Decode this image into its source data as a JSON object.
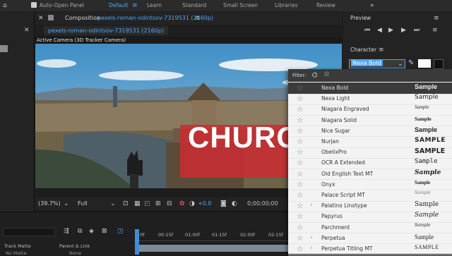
{
  "topbar": {
    "auto_open_label": "Auto-Open Panel",
    "workspaces": [
      "Default",
      "Learn",
      "Standard",
      "Small Screen",
      "Libraries",
      "Review"
    ],
    "active_workspace": "Default",
    "menu_icon": "hamburger-icon",
    "overflow_icon": "double-chevron-icon"
  },
  "composition": {
    "header_label": "Composition",
    "name": "pexels-roman-odintsov-7319531 (2160p)",
    "tab_label": "pexels-roman-odintsov-7319531 (2160p)",
    "camera_label": "Active Camera (3D Tracker Camera)",
    "overlay_text": "CHURCH",
    "overlay_color": "#d02a2f"
  },
  "viewer_toolbar": {
    "zoom": "(39.7%)",
    "resolution": "Full",
    "exposure": "+0.0",
    "timecode": "0;00;00;00"
  },
  "preview_panel": {
    "title": "Preview"
  },
  "character_panel": {
    "title": "Character",
    "font_value": "Nexa Bold"
  },
  "font_menu": {
    "filter_label": "Filter:",
    "fonts": [
      {
        "name": "Nexa Bold",
        "sample": "Sample",
        "expandable": false,
        "selected": true
      },
      {
        "name": "Nexa Light",
        "sample": "Sample",
        "expandable": false,
        "selected": false
      },
      {
        "name": "Niagara Engraved",
        "sample": "Sample",
        "expandable": false,
        "selected": false
      },
      {
        "name": "Niagara Solid",
        "sample": "Sample",
        "expandable": false,
        "selected": false
      },
      {
        "name": "Nice Sugar",
        "sample": "Sample",
        "expandable": false,
        "selected": false
      },
      {
        "name": "Nurjan",
        "sample": "SAMPLE",
        "expandable": false,
        "selected": false
      },
      {
        "name": "ObelixPro",
        "sample": "SAMPLE",
        "expandable": false,
        "selected": false
      },
      {
        "name": "OCR A Extended",
        "sample": "Sample",
        "expandable": false,
        "selected": false
      },
      {
        "name": "Old English Text MT",
        "sample": "Sample",
        "expandable": false,
        "selected": false
      },
      {
        "name": "Onyx",
        "sample": "Sample",
        "expandable": false,
        "selected": false
      },
      {
        "name": "Palace Script MT",
        "sample": "Sample",
        "expandable": false,
        "selected": false
      },
      {
        "name": "Palatino Linotype",
        "sample": "Sample",
        "expandable": true,
        "selected": false
      },
      {
        "name": "Papyrus",
        "sample": "Sample",
        "expandable": false,
        "selected": false
      },
      {
        "name": "Parchment",
        "sample": "Sample",
        "expandable": false,
        "selected": false
      },
      {
        "name": "Perpetua",
        "sample": "Sample",
        "expandable": true,
        "selected": false
      },
      {
        "name": "Perpetua Titling MT",
        "sample": "SAMPLE",
        "expandable": true,
        "selected": false
      }
    ]
  },
  "timeline": {
    "track_matte_label": "Track Matte",
    "parent_link_label": "Parent & Link",
    "no_matte_value": "No Matte",
    "none_value": "None",
    "ruler": [
      "0f",
      "00:15f",
      "01:00f",
      "01:15f",
      "02:00f",
      "02:15f"
    ]
  }
}
